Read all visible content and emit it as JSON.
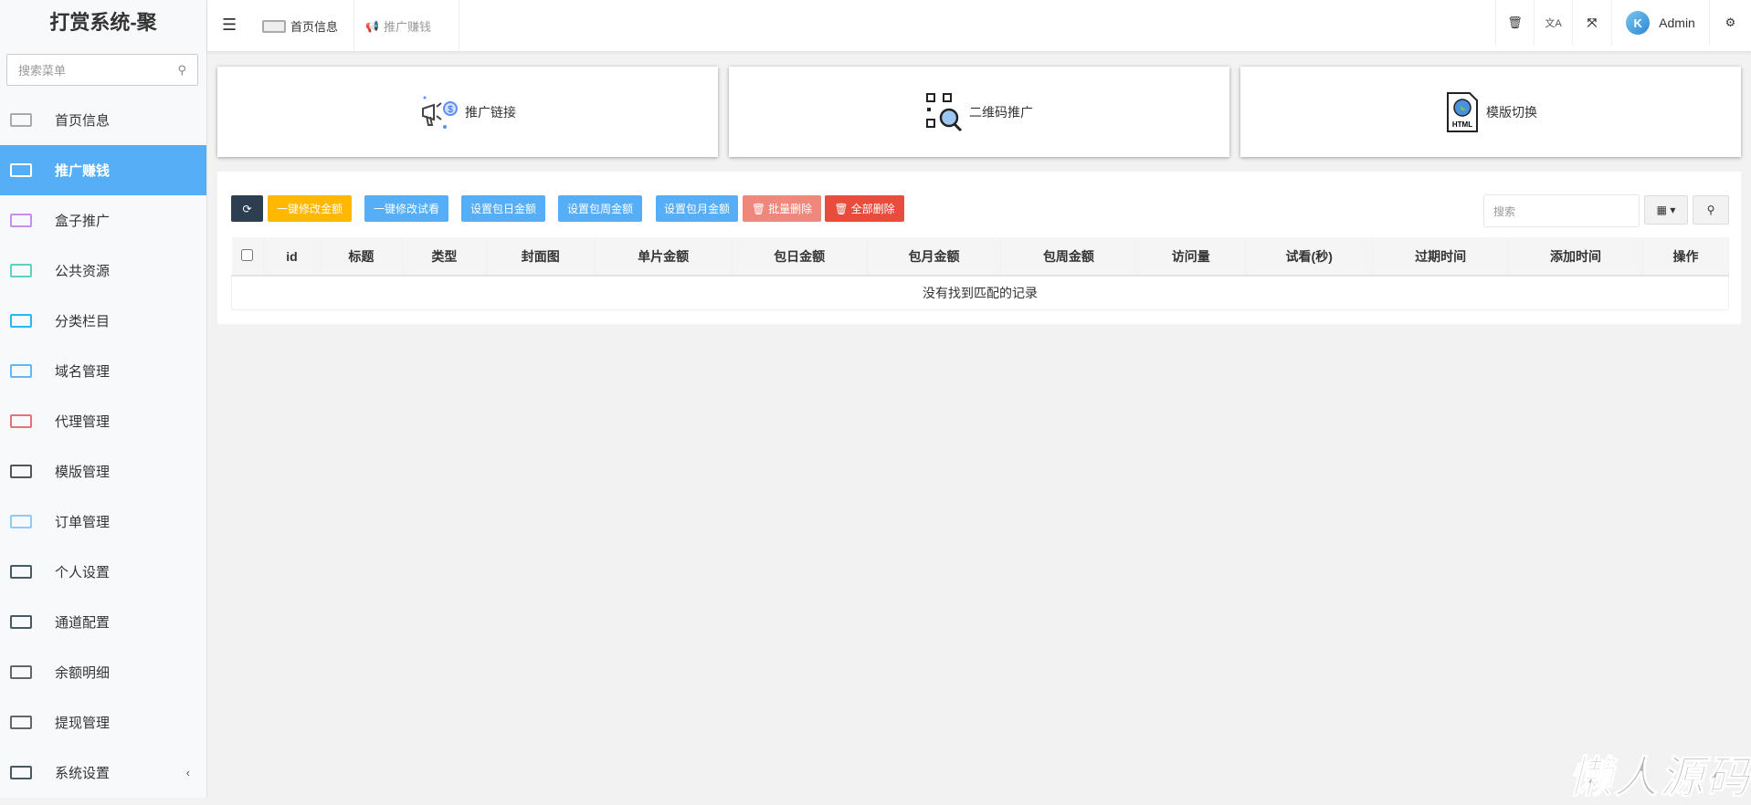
{
  "app": {
    "title": "打赏系统-聚"
  },
  "sidebar": {
    "search_placeholder": "搜索菜单",
    "items": [
      {
        "label": "首页信息",
        "icon": "home-screen-icon"
      },
      {
        "label": "推广赚钱",
        "icon": "megaphone-icon",
        "active": true
      },
      {
        "label": "盒子推广",
        "icon": "box-icon"
      },
      {
        "label": "公共资源",
        "icon": "resource-icon"
      },
      {
        "label": "分类栏目",
        "icon": "list-sort-icon"
      },
      {
        "label": "域名管理",
        "icon": "domain-icon"
      },
      {
        "label": "代理管理",
        "icon": "agent-icon"
      },
      {
        "label": "模版管理",
        "icon": "html-template-icon"
      },
      {
        "label": "订单管理",
        "icon": "order-icon"
      },
      {
        "label": "个人设置",
        "icon": "personal-settings-icon"
      },
      {
        "label": "通道配置",
        "icon": "channel-icon"
      },
      {
        "label": "余额明细",
        "icon": "balance-icon"
      },
      {
        "label": "提现管理",
        "icon": "withdraw-icon"
      },
      {
        "label": "系统设置",
        "icon": "system-settings-icon",
        "chevron": "‹"
      }
    ]
  },
  "header": {
    "tabs": [
      {
        "label": "首页信息"
      },
      {
        "label": "推广赚钱"
      }
    ],
    "user": "Admin"
  },
  "cards": [
    {
      "label": "推广链接"
    },
    {
      "label": "二维码推广"
    },
    {
      "label": "模版切换"
    }
  ],
  "toolbar": {
    "buttons": [
      "一键修改金额",
      "一键修改试看",
      "设置包日金额",
      "设置包周金额",
      "设置包月金额",
      "批量删除",
      "全部删除"
    ],
    "search_placeholder": "搜索"
  },
  "colors": {
    "accent": "#56aef7",
    "warning": "#ffb800",
    "danger": "#e74c3c",
    "danger_light": "#f0877d",
    "dark": "#2c3e50"
  },
  "table": {
    "columns": [
      "id",
      "标题",
      "类型",
      "封面图",
      "单片金额",
      "包日金额",
      "包月金额",
      "包周金额",
      "访问量",
      "试看(秒)",
      "过期时间",
      "添加时间",
      "操作"
    ],
    "empty": "没有找到匹配的记录"
  },
  "watermark": "懒人源码"
}
